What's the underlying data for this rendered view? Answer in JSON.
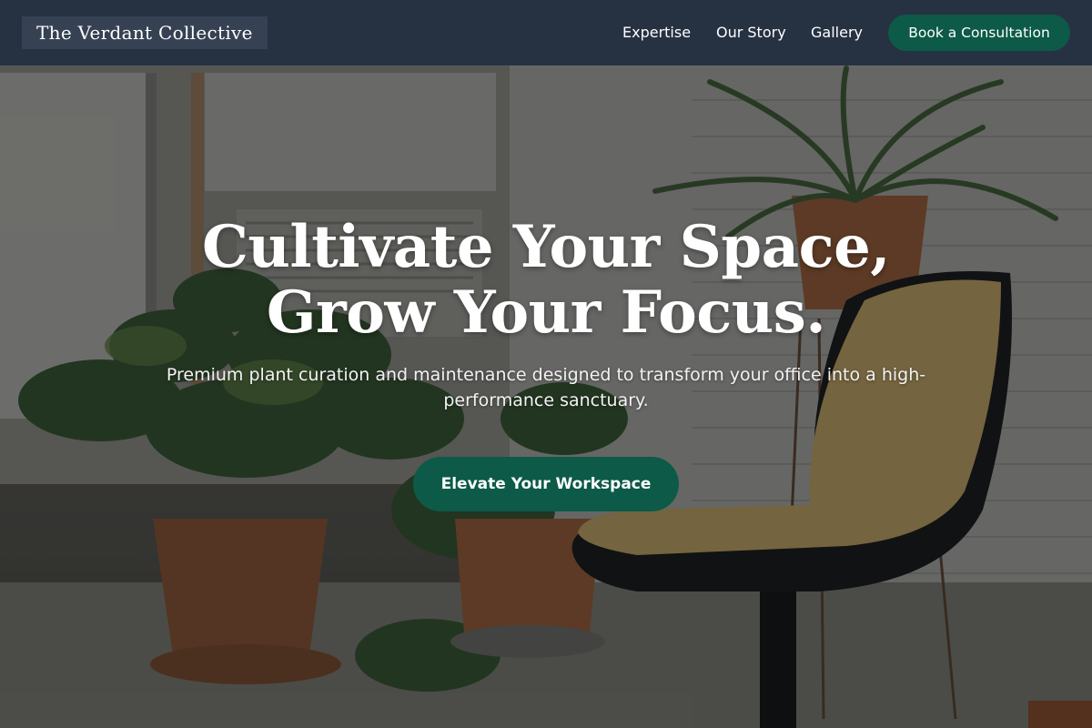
{
  "nav": {
    "brand": "The Verdant Collective",
    "links": [
      "Expertise",
      "Our Story",
      "Gallery"
    ],
    "cta_label": "Book a Consultation"
  },
  "hero": {
    "headline_line1": "Cultivate Your Space,",
    "headline_line2": "Grow Your Focus.",
    "subtitle": "Premium plant curation and maintenance designed to transform your office into a high-performance sanctuary.",
    "cta_label": "Elevate Your Workspace"
  },
  "colors": {
    "navbar_bg": "#263242",
    "accent_green": "#0c5a47",
    "headline_text": "#ffffff"
  }
}
